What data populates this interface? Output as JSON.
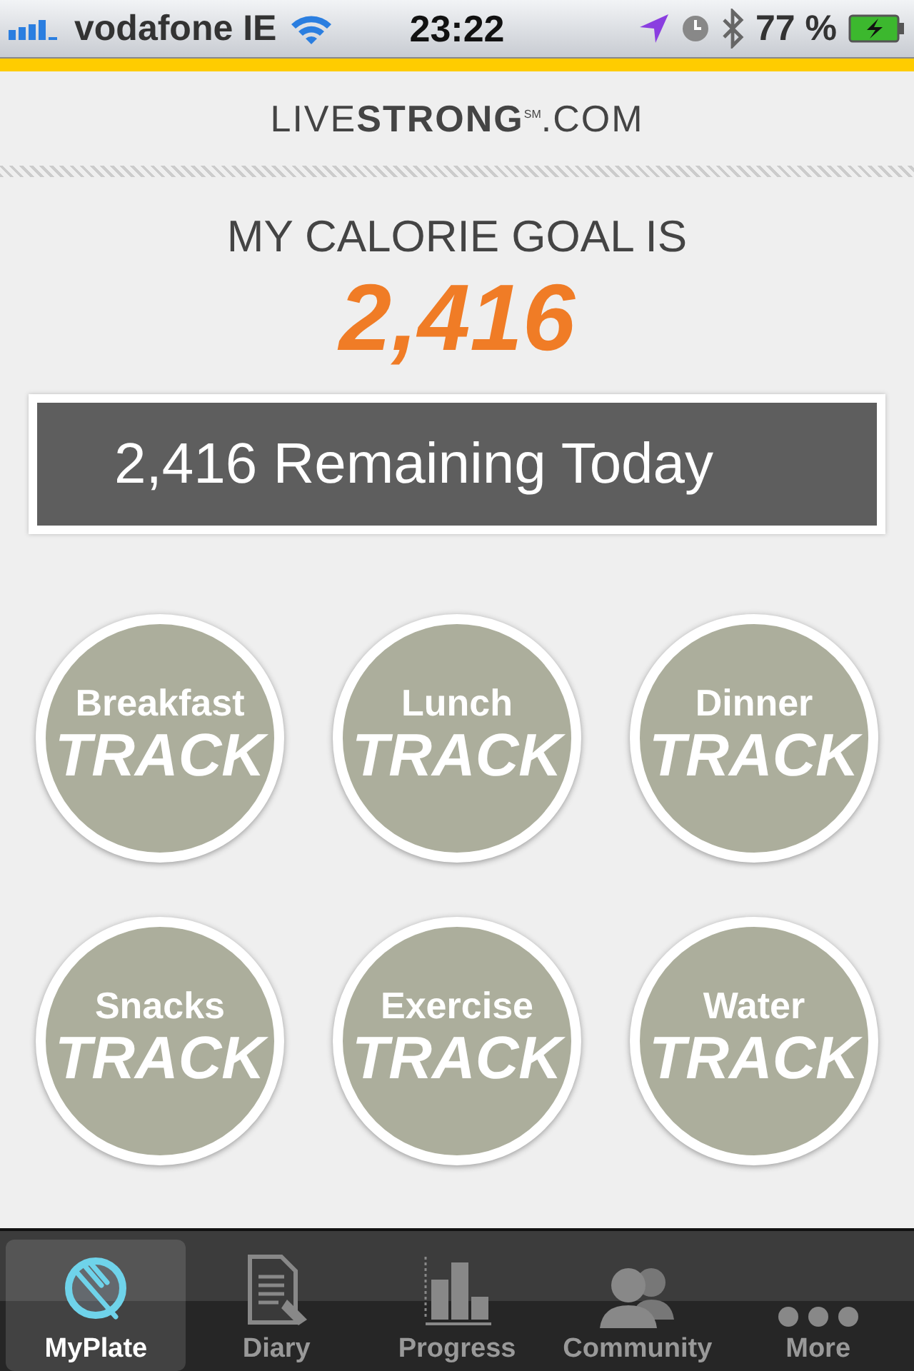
{
  "status_bar": {
    "carrier": "vodafone IE",
    "time": "23:22",
    "battery": "77 %"
  },
  "header": {
    "logo": "LIVE**STRONG**$^{SM}$.COM"
  },
  "goal": {
    "label": "MY CALORIE GOAL IS",
    "value": "2,416"
  },
  "remaining": "2,416 Remaining Today",
  "meals": [
    {
      "name": "Breakfast",
      "action": "TRACK"
    },
    {
      "name": "Lunch",
      "action": "TRACK"
    },
    {
      "name": "Dinner",
      "action": "TRACK"
    },
    {
      "name": "Snacks",
      "action": "TRACK"
    },
    {
      "name": "Exercise",
      "action": "TRACK"
    },
    {
      "name": "Water",
      "action": "TRACK"
    }
  ],
  "tab_bar": [
    {
      "label": "MyPlate",
      "kind": "plate",
      "selected": true
    },
    {
      "label": "Diary",
      "kind": "diary",
      "selected": false
    },
    {
      "label": "Progress",
      "kind": "chart",
      "selected": false
    },
    {
      "label": "Community",
      "kind": "people",
      "selected": false
    },
    {
      "label": "More",
      "kind": "more",
      "selected": false
    }
  ]
}
